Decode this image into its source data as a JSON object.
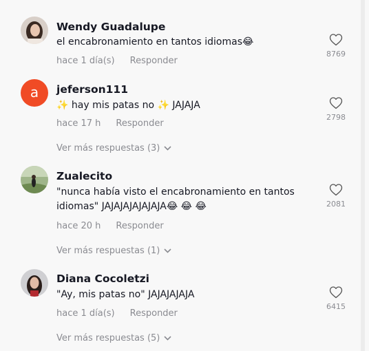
{
  "comments": [
    {
      "username": "Wendy Guadalupe",
      "text": "el encabronamiento en tantos idiomas😂",
      "time": "hace 1 día(s)",
      "reply_label": "Responder",
      "likes": "8769",
      "avatar_type": "photo"
    },
    {
      "username": "jeferson111",
      "text": "✨ hay mis patas no  ✨ JAJAJA",
      "time": "hace 17 h",
      "reply_label": "Responder",
      "likes": "2798",
      "avatar_type": "letter",
      "avatar_letter": "a",
      "avatar_color": "#f04b25",
      "more_replies": "Ver más respuestas (3)"
    },
    {
      "username": "Zualecito",
      "text": "\"nunca había visto el encabronamiento en tantos idiomas\" JAJAJAJAJAJAJA😂 😂 😂",
      "time": "hace 20 h",
      "reply_label": "Responder",
      "likes": "2081",
      "avatar_type": "photo",
      "more_replies": "Ver más respuestas (1)"
    },
    {
      "username": "Diana Cocoletzi",
      "text": "\"Ay, mis patas no\" JAJAJAJAJA",
      "time": "hace 1 día(s)",
      "reply_label": "Responder",
      "likes": "6415",
      "avatar_type": "photo",
      "more_replies": "Ver más respuestas (5)"
    }
  ],
  "icons": {
    "like": "heart-outline-icon",
    "more_replies": "chevron-down-icon"
  },
  "colors": {
    "username": "#161823",
    "muted": "#8a8b91",
    "background": "#f8f8f8"
  }
}
